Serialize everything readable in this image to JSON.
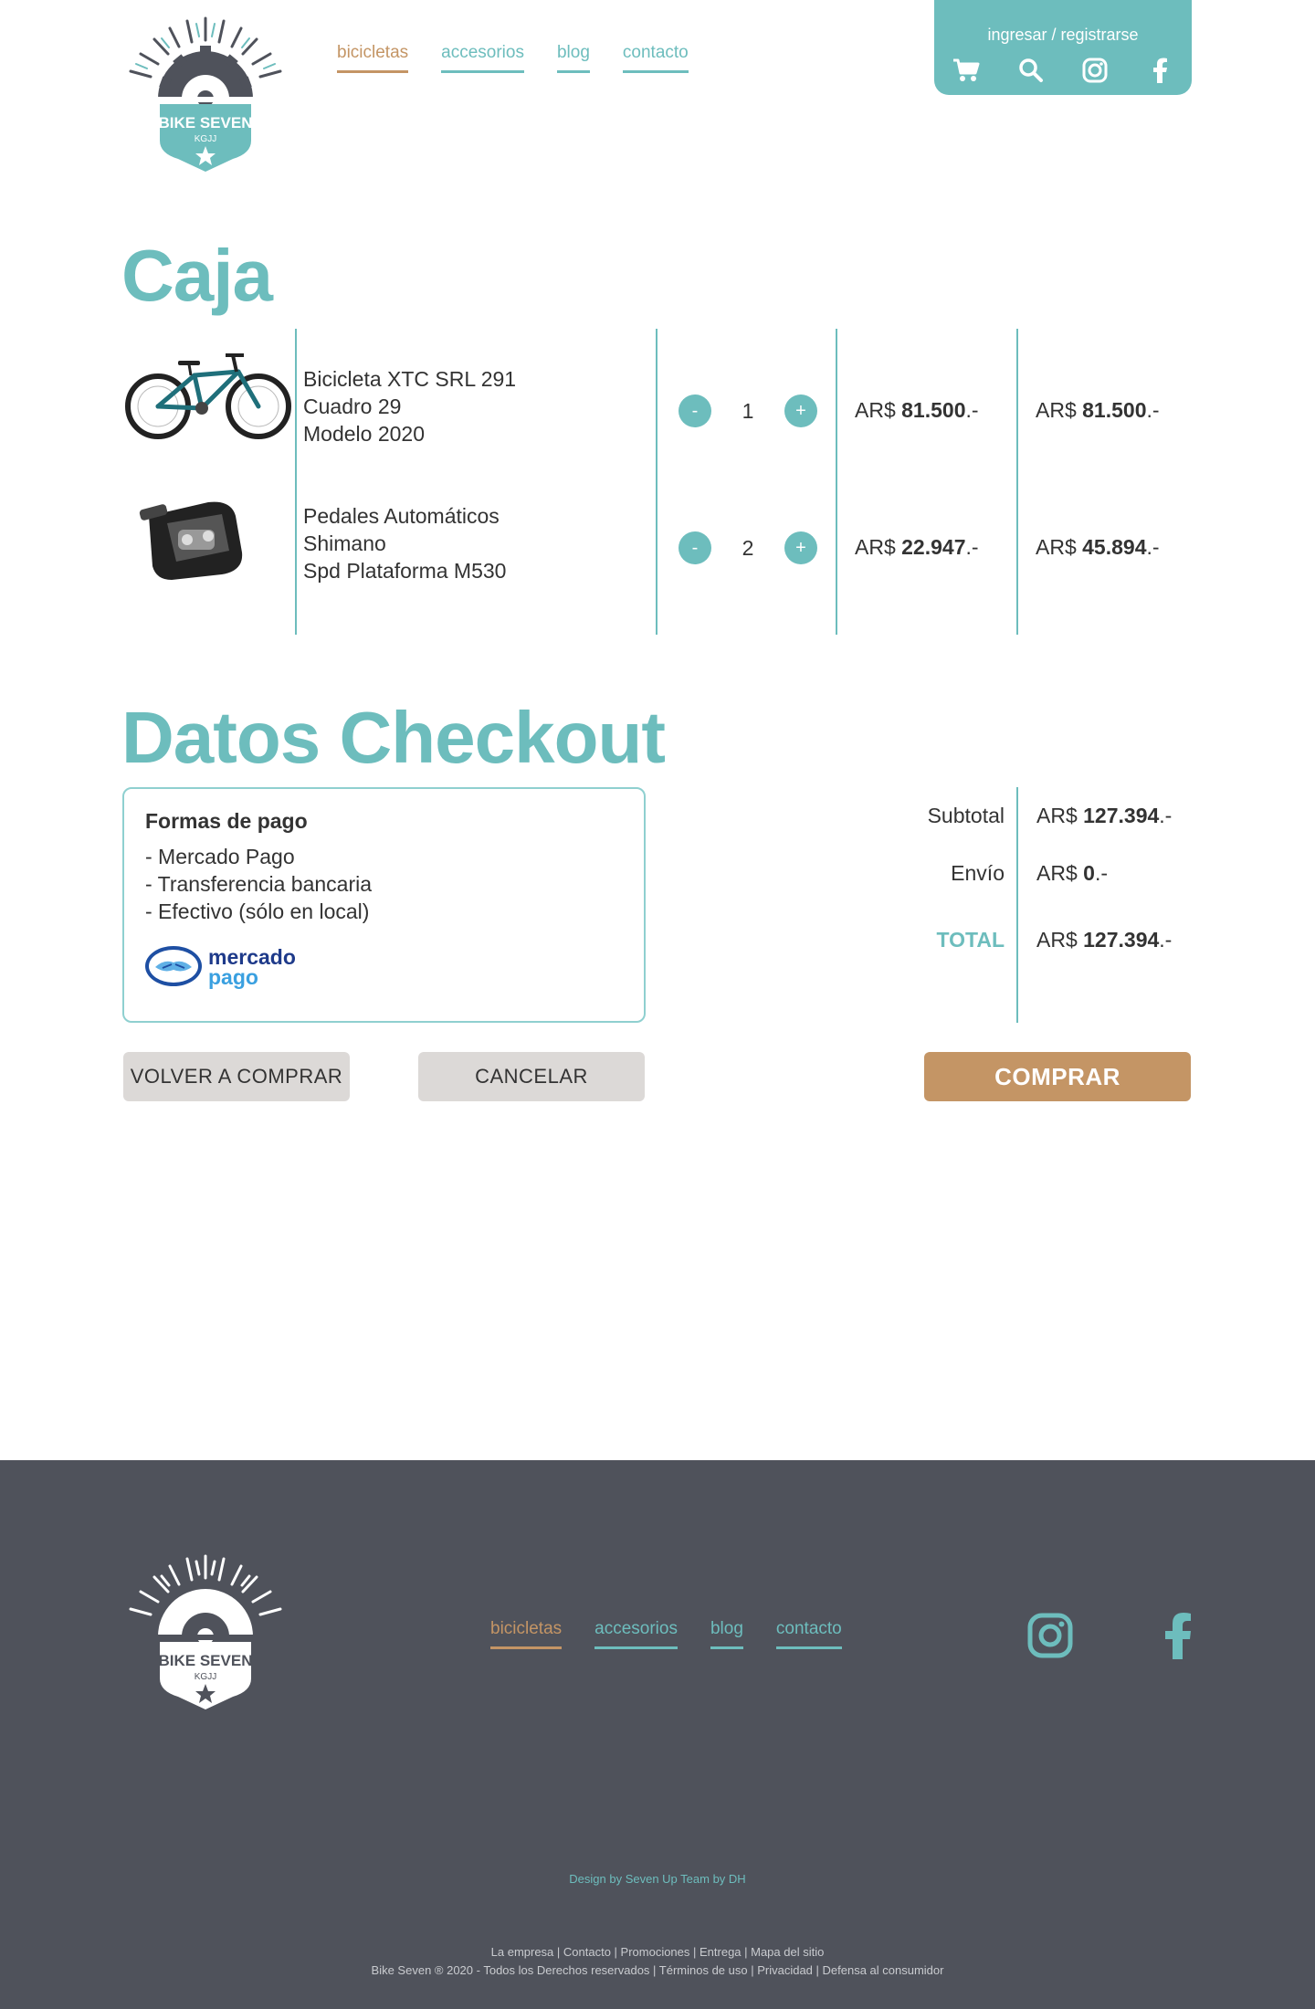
{
  "header": {
    "brand": "BIKE SEVEN",
    "brand_sub": "KGJJ",
    "nav": [
      "bicicletas",
      "accesorios",
      "blog",
      "contacto"
    ],
    "login": "ingresar / registrarse",
    "icons": [
      "cart-icon",
      "search-icon",
      "instagram-icon",
      "facebook-icon"
    ]
  },
  "cart": {
    "title": "Caja",
    "items": [
      {
        "name_lines": [
          "Bicicleta XTC SRL 291",
          "Cuadro 29",
          "Modelo 2020"
        ],
        "qty": "1",
        "minus": "-",
        "plus": "+",
        "unit_prefix": "AR$ ",
        "unit_price": "81.500",
        "unit_suffix": ".-",
        "total_prefix": "AR$ ",
        "total_price": "81.500",
        "total_suffix": ".-"
      },
      {
        "name_lines": [
          "Pedales Automáticos",
          "Shimano",
          "Spd Plataforma M530"
        ],
        "qty": "2",
        "minus": "-",
        "plus": "+",
        "unit_prefix": "AR$ ",
        "unit_price": "22.947",
        "unit_suffix": ".-",
        "total_prefix": "AR$ ",
        "total_price": "45.894",
        "total_suffix": ".-"
      }
    ]
  },
  "checkout": {
    "title": "Datos Checkout",
    "payment_title": "Formas de pago",
    "payment_methods": [
      "- Mercado Pago",
      "- Transferencia bancaria",
      "- Efectivo (sólo en local)"
    ],
    "mp_logo_top": "mercado",
    "mp_logo_bottom": "pago",
    "subtotal_label": "Subtotal",
    "subtotal_prefix": "AR$ ",
    "subtotal_value": "127.394",
    "subtotal_suffix": ".-",
    "shipping_label": "Envío",
    "shipping_prefix": "AR$ ",
    "shipping_value": "0",
    "shipping_suffix": ".-",
    "total_label": "TOTAL",
    "total_prefix": "AR$ ",
    "total_value": "127.394",
    "total_suffix": ".-",
    "btn_back": "VOLVER A COMPRAR",
    "btn_cancel": "CANCELAR",
    "btn_buy": "COMPRAR"
  },
  "footer": {
    "nav": [
      "bicicletas",
      "accesorios",
      "blog",
      "contacto"
    ],
    "credit": "Design by Seven Up Team by DH",
    "links": "La empresa | Contacto | Promociones | Entrega | Mapa del sitio",
    "legal": "Bike Seven ®  2020 - Todos los Derechos reservados | Términos de uso | Privacidad | Defensa al consumidor"
  },
  "colors": {
    "accent": "#6dbdbd",
    "brand_brown": "#c49565",
    "footer_bg": "#4f525b",
    "grey_button": "#dcd9d7"
  }
}
